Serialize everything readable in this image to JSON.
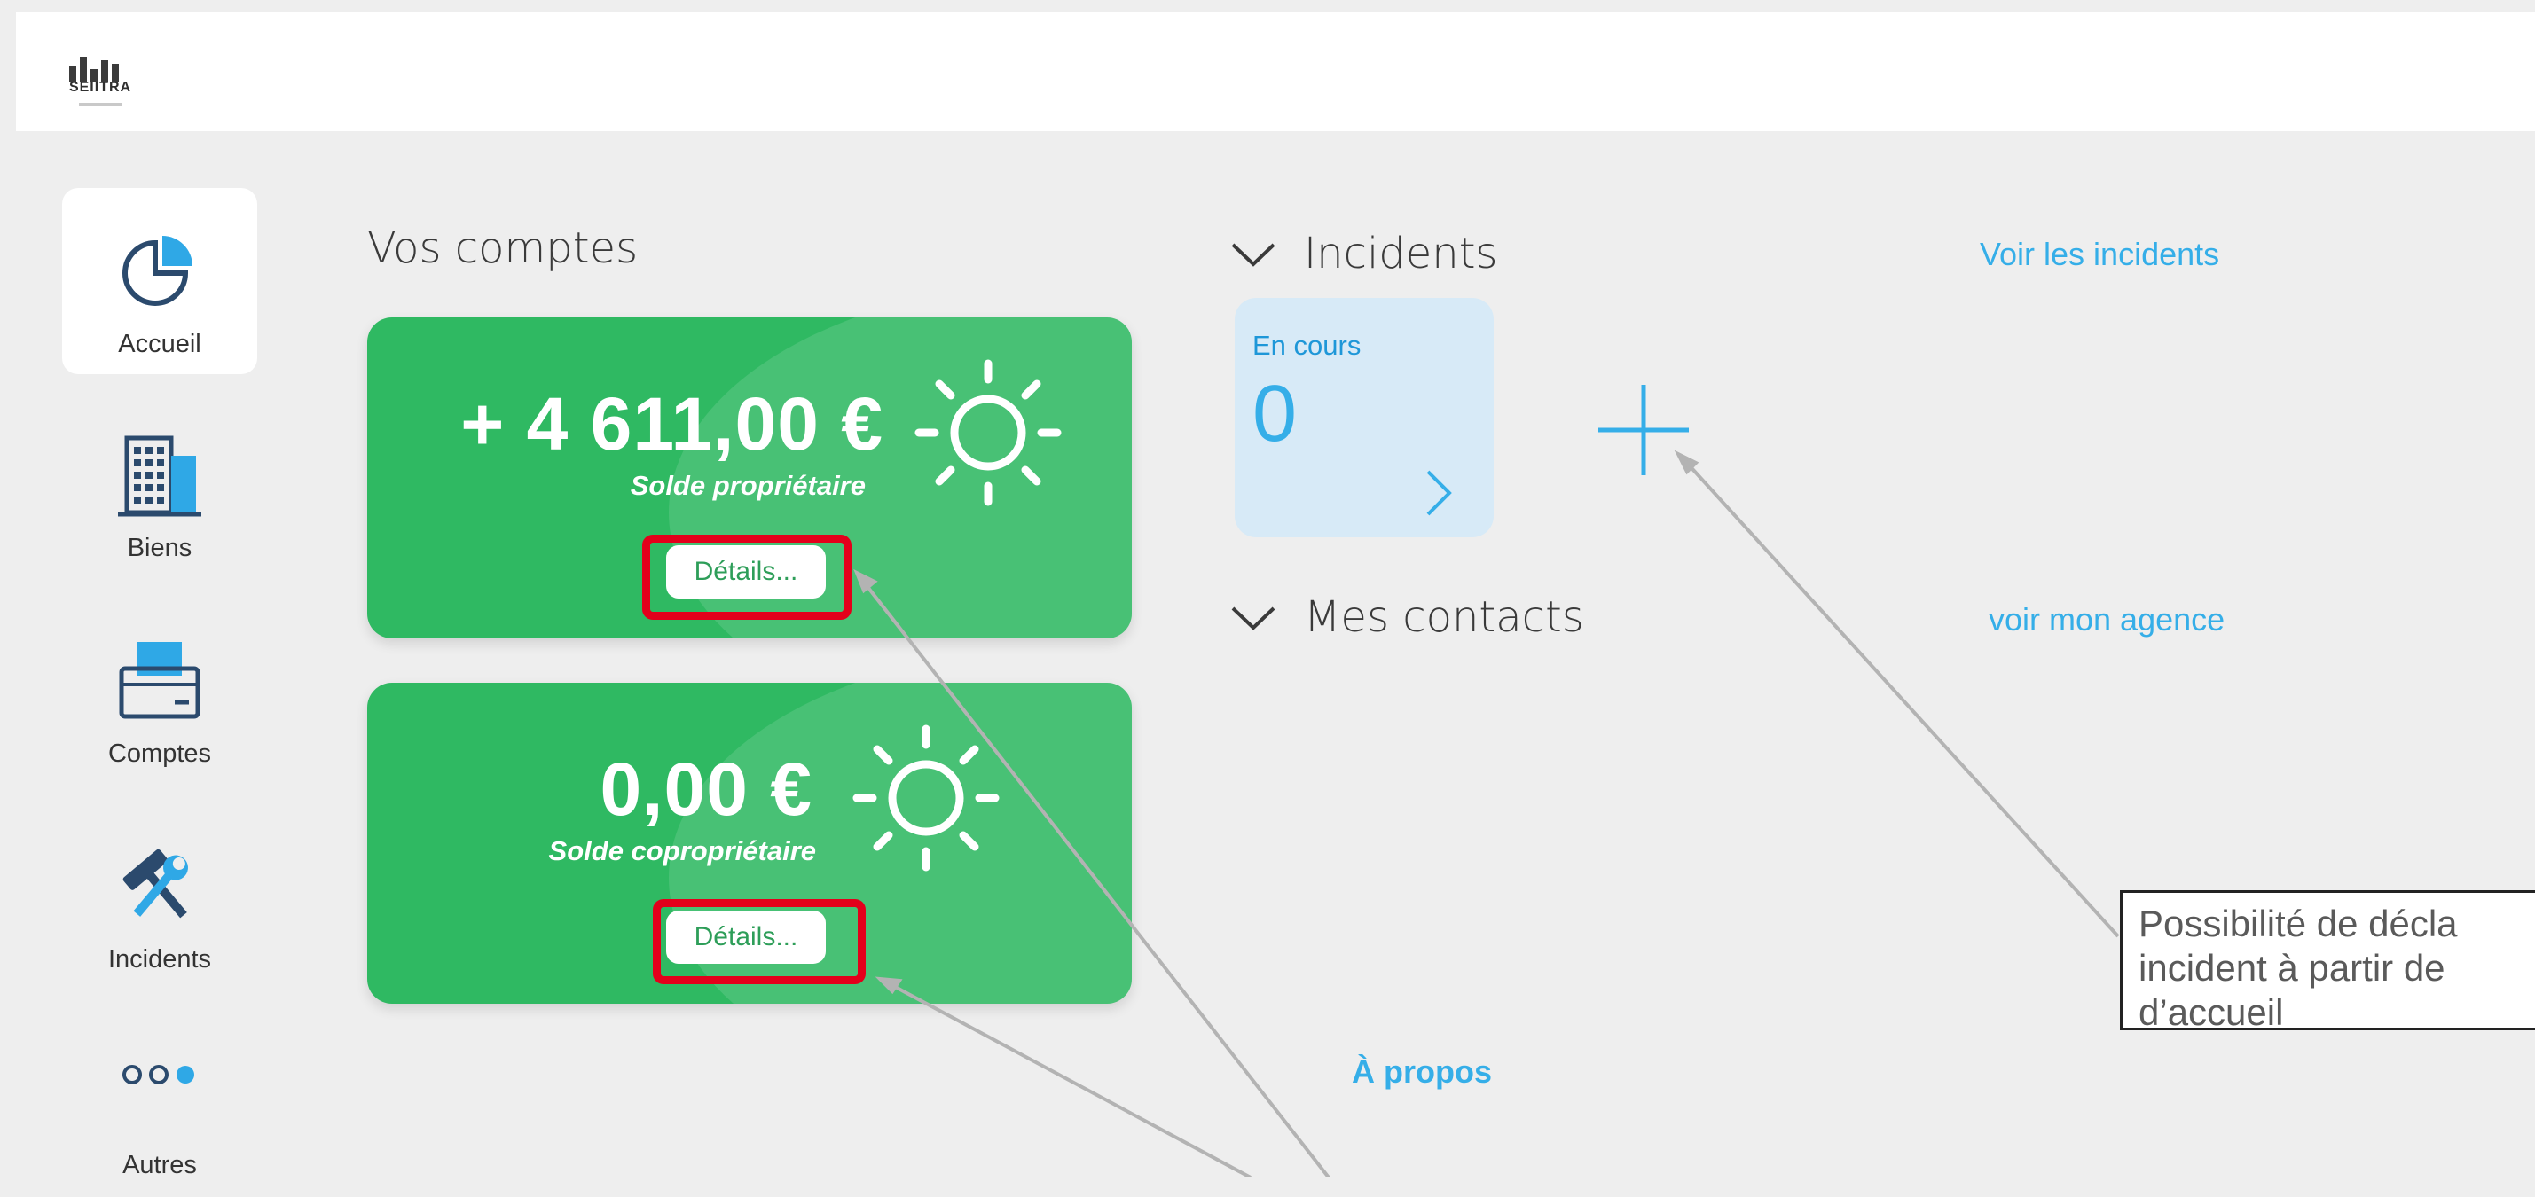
{
  "brand": {
    "name": "SEIITRA"
  },
  "sidebar": {
    "items": [
      {
        "label": "Accueil",
        "icon": "pie-chart-icon",
        "active": true
      },
      {
        "label": "Biens",
        "icon": "building-icon"
      },
      {
        "label": "Comptes",
        "icon": "printer-icon"
      },
      {
        "label": "Incidents",
        "icon": "tools-icon"
      },
      {
        "label": "Autres",
        "icon": "more-dots-icon"
      }
    ]
  },
  "accounts": {
    "title": "Vos comptes",
    "cards": [
      {
        "amount": "+ 4 611,00 €",
        "caption": "Solde propriétaire",
        "details_label": "Détails...",
        "icon": "sun-icon"
      },
      {
        "amount": "0,00 €",
        "caption": "Solde copropriétaire",
        "details_label": "Détails...",
        "icon": "sun-icon"
      }
    ]
  },
  "incidents": {
    "title": "Incidents",
    "link": "Voir les incidents",
    "tile": {
      "status": "En cours",
      "count": "0"
    }
  },
  "contacts": {
    "title": "Mes contacts",
    "link": "voir mon agence"
  },
  "footer": {
    "about": "À propos"
  },
  "annotation": {
    "lines": [
      "Possibilité de décla",
      "incident à partir de",
      "d’accueil"
    ]
  },
  "colors": {
    "card_green": "#2fb962",
    "accent_blue": "#35aee8",
    "highlight_red": "#e3001b",
    "sidebar_icon": "#2b4a6d"
  }
}
